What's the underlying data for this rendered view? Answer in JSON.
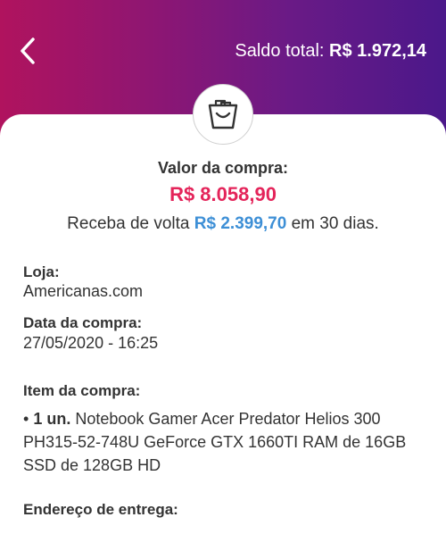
{
  "header": {
    "saldo_label": "Saldo total:",
    "saldo_value": "R$ 1.972,14"
  },
  "purchase": {
    "valor_label": "Valor da compra:",
    "valor_amount": "R$ 8.058,90",
    "cashback_prefix": "Receba de volta",
    "cashback_amount": "R$ 2.399,70",
    "cashback_suffix": "em 30 dias."
  },
  "details": {
    "loja_label": "Loja:",
    "loja_value": "Americanas.com",
    "data_label": "Data da compra:",
    "data_value": "27/05/2020 - 16:25",
    "item_label": "Item da compra:",
    "item_bullet": "•",
    "item_qty": "1 un.",
    "item_desc": "Notebook Gamer Acer Predator Helios 300 PH315-52-748U GeForce GTX 1660TI RAM de 16GB SSD de 128GB HD",
    "endereco_label": "Endereço de entrega:"
  },
  "icons": {
    "back": "chevron-left-icon",
    "bag": "shopping-bag-icon"
  },
  "colors": {
    "header_start": "#b0135e",
    "header_end": "#4b188a",
    "amount": "#e4245a",
    "cashback": "#3d8fd6"
  }
}
